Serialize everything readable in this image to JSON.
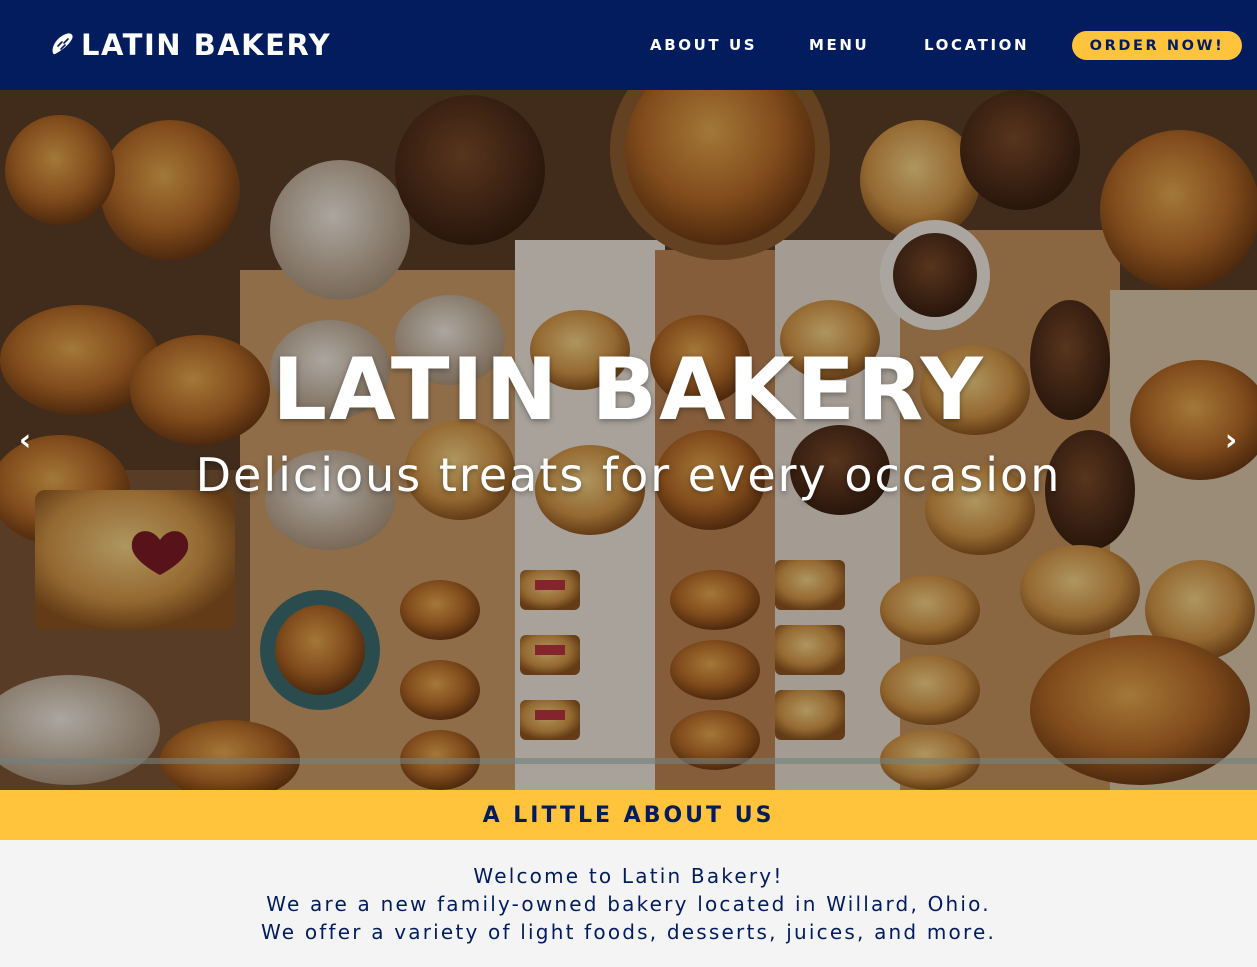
{
  "navbar": {
    "brand_text": "LATIN BAKERY",
    "brand_icon": "bread-icon",
    "links": [
      {
        "label": "ABOUT US"
      },
      {
        "label": "MENU"
      },
      {
        "label": "LOCATION"
      }
    ],
    "order_label": "ORDER NOW!"
  },
  "hero": {
    "title": "LATIN BAKERY",
    "subtitle": "Delicious treats for every occasion",
    "prev_arrow": "‹",
    "next_arrow": "›"
  },
  "about": {
    "heading": "A LITTLE ABOUT US",
    "lines": [
      "Welcome to Latin Bakery!",
      "We are a new family-owned bakery located in Willard, Ohio.",
      "We offer a variety of light foods, desserts, juices, and more."
    ]
  },
  "colors": {
    "navy": "#031c5e",
    "yellow": "#ffc43c",
    "light_bg": "#f4f4f4"
  }
}
